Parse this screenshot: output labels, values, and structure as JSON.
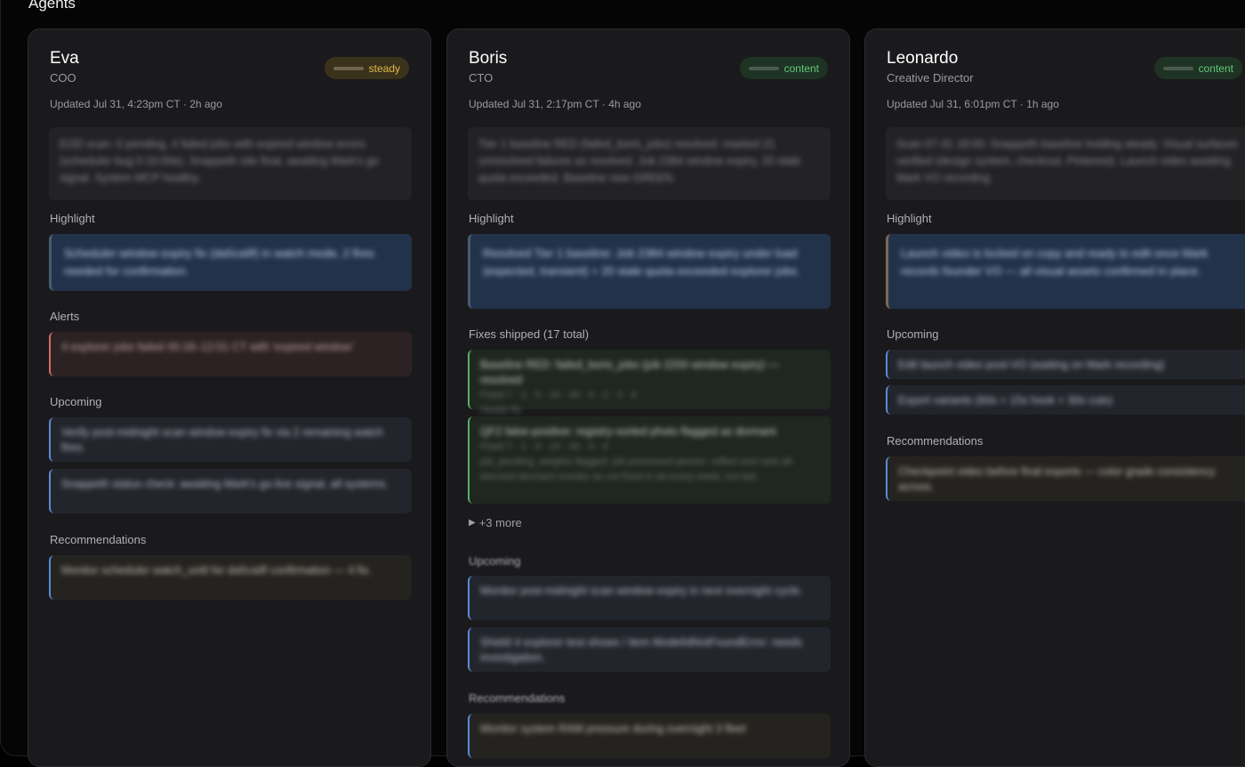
{
  "section": {
    "title": "Agents"
  },
  "agents": [
    {
      "name": "Eva",
      "role": "COO",
      "status": "steady",
      "updated": "Updated Jul 31, 4:23pm CT · 2h ago",
      "summary": "EOD scan: 0 pending, 4 failed jobs with expired window errors (scheduler bug 0:10:00e). Snappeth site final, awaiting Mark's go signal. System MCP healthy.",
      "highlight_label": "Highlight",
      "highlight": "Scheduler window expiry fix (da5ca9f) in watch mode, 2 fires needed for confirmation.",
      "alerts_label": "Alerts",
      "alerts": [
        "4 explorer jobs failed 00:18–12:01 CT with 'expired window'"
      ],
      "upcoming_label": "Upcoming",
      "upcoming": [
        "Verify post-midnight scan window expiry fix via 2 remaining watch fires.",
        "Snappeth status check: awaiting Mark's go-live signal, all systems."
      ],
      "recommendations_label": "Recommendations",
      "recommendations": [
        "Monitor scheduler watch_until for da5ca9f confirmation — 4 fix."
      ]
    },
    {
      "name": "Boris",
      "role": "CTO",
      "status": "content",
      "updated": "Updated Jul 31, 2:17pm CT · 4h ago",
      "summary": "Tier 1 baseline RED (failed_boris_jobs) resolved: marked 21 unresolved failures as resolved. Job 2384 window expiry, 20 stale quota exceeded. Baseline now GREEN.",
      "highlight_label": "Highlight",
      "highlight": "Resolved Tier 1 baseline: Job 2384 window expiry under load (expected, transient) + 20 stale quota exceeded explorer jobs.",
      "fixes_label": "Fixes shipped (17 total)",
      "fixes": [
        {
          "title": "Baseline RED: failed_boris_jobs (job 2200 window expiry) — resolved",
          "sub": "Fixed 7 · 2 · 5 · 14 · 44 · 4 · 2 · 3 · 4",
          "detail": "Heads fix."
        },
        {
          "title": "QF2 false-positive: registry-sorted photo flagged as dormant",
          "sub": "Fixed 7 · 1 · 4 · 14 · 44 · 4 · 4",
          "detail": "job_pending_weights flagged: job processed person: reflect and rank all-dormant dormant monitor as not fixed in de-every week; not last."
        }
      ],
      "more_label": "+3 more",
      "upcoming_label": "Upcoming",
      "upcoming": [
        "Monitor post-midnight scan window expiry in next overnight cycle.",
        "Shield 4 explorer test shows / item ModelIdNotFoundError: needs investigation."
      ],
      "recommendations_label": "Recommendations",
      "recommendations": [
        "Monitor system RAM pressure during overnight 3 fleet"
      ]
    },
    {
      "name": "Leonardo",
      "role": "Creative Director",
      "status": "content",
      "updated": "Updated Jul 31, 6:01pm CT · 1h ago",
      "summary": "Scan 07-31 18:00: Snappeth baseline holding steady. Visual surfaces verified (design system, checkout, Pinterest). Launch video awaiting Mark VO recording.",
      "highlight_label": "Highlight",
      "highlight": "Launch video is locked on copy and ready to edit once Mark records founder VO — all visual assets confirmed in place.",
      "upcoming_label": "Upcoming",
      "upcoming": [
        "Edit launch video post-VO (waiting on Mark recording)",
        "Export variants (60s + 15s hook + 30s cuts)"
      ],
      "recommendations_label": "Recommendations",
      "recommendations": [
        "Checkpoint video before final exports — color grade consistency across."
      ]
    }
  ],
  "colors": {
    "steady": "#e0b949",
    "content": "#5fc776",
    "upcoming_border": "#5b8ad8",
    "alert_border": "#d46a66",
    "fix_border": "#55b06a"
  }
}
